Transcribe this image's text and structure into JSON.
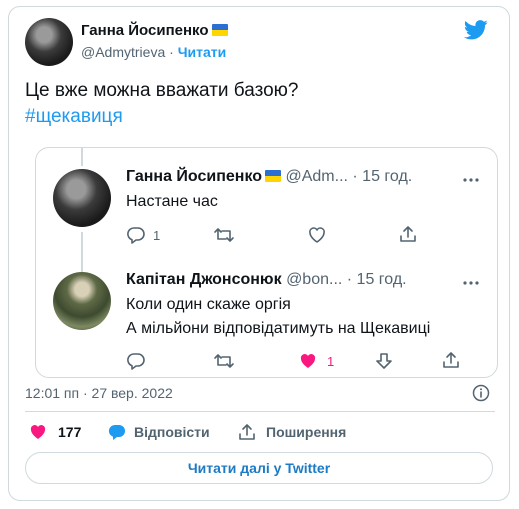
{
  "tweet": {
    "author_name": "Ганна Йосипенко",
    "author_handle": "@Admytrieva",
    "separator": "·",
    "follow_label": "Читати",
    "text": "Це вже можна вважати базою?",
    "hashtag": "#щекавиця",
    "timestamp": "12:01 пп · 27 вер. 2022",
    "likes_count": "177",
    "reply_label": "Відповісти",
    "share_label": "Поширення",
    "read_more_label": "Читати далі у Twitter"
  },
  "thread": [
    {
      "author_name": "Ганна Йосипенко",
      "handle_time": "@Adm... · 15 год.",
      "text": "Настане час",
      "reply_count": "1",
      "like_count": ""
    },
    {
      "author_name": "Капітан Джонсонюк",
      "handle_time": "@bon... · 15 год.",
      "text_line1": "Коли один скаже оргія",
      "text_line2": "А мільйони відповідатимуть на Щекавиці",
      "reply_count": "",
      "like_count": "1"
    }
  ],
  "icons": [
    "twitter-bird-icon",
    "ukraine-flag-icon",
    "reply-icon",
    "retweet-icon",
    "heart-icon",
    "share-icon",
    "more-icon",
    "info-icon",
    "downvote-icon"
  ],
  "colors": {
    "accent": "#1d9bf0",
    "like": "#f91880",
    "muted": "#536471",
    "border": "#cfd9de"
  }
}
